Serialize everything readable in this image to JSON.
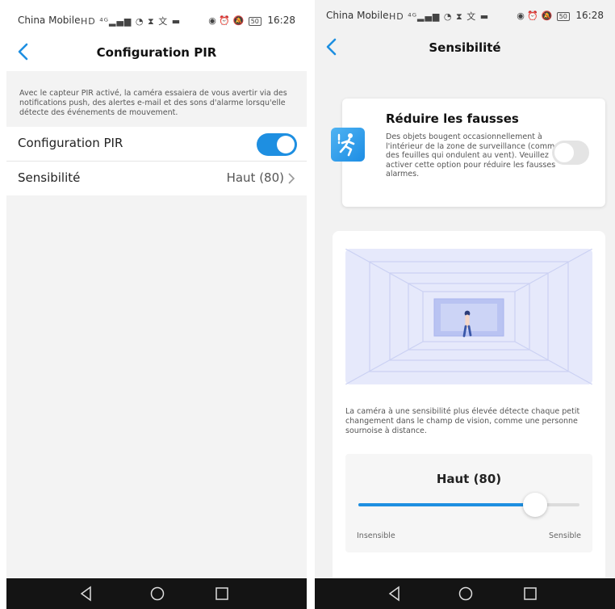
{
  "status_bar": {
    "carrier": "China Mobile",
    "time": "16:28",
    "battery_left": "50",
    "battery_right": "50"
  },
  "left_screen": {
    "title": "Configuration PIR",
    "description": "Avec le capteur PIR activé, la caméra essaiera de vous avertir via des notifications push, des alertes e-mail et des sons d'alarme lorsqu'elle détecte des événements de mouvement.",
    "pir_row": {
      "label": "Configuration PIR",
      "enabled": true
    },
    "sensitivity_row": {
      "label": "Sensibilité",
      "value": "Haut (80)"
    }
  },
  "right_screen": {
    "title": "Sensibilité",
    "false_alarm_card": {
      "title": "Réduire les fausses",
      "text": "Des objets bougent occasionnellement à l'intérieur de la zone de surveillance (comme des feuilles qui ondulent au vent). Veuillez activer cette option pour réduire les fausses alarmes.",
      "enabled": false
    },
    "info_text": "La caméra à une sensibilité plus élevée détecte chaque petit changement dans le champ de vision, comme une personne sournoise à distance.",
    "slider": {
      "value_label": "Haut (80)",
      "value": 80,
      "max": 100,
      "min_label": "Insensible",
      "max_label": "Sensible"
    }
  },
  "colors": {
    "accent": "#1e8fe1",
    "toggle_off": "#e4e4e4",
    "navbar_dark": "#141414"
  },
  "icons": [
    "back-arrow-icon",
    "chevron-right-icon",
    "running-person-icon",
    "nav-back-icon",
    "nav-home-icon",
    "nav-recents-icon"
  ]
}
